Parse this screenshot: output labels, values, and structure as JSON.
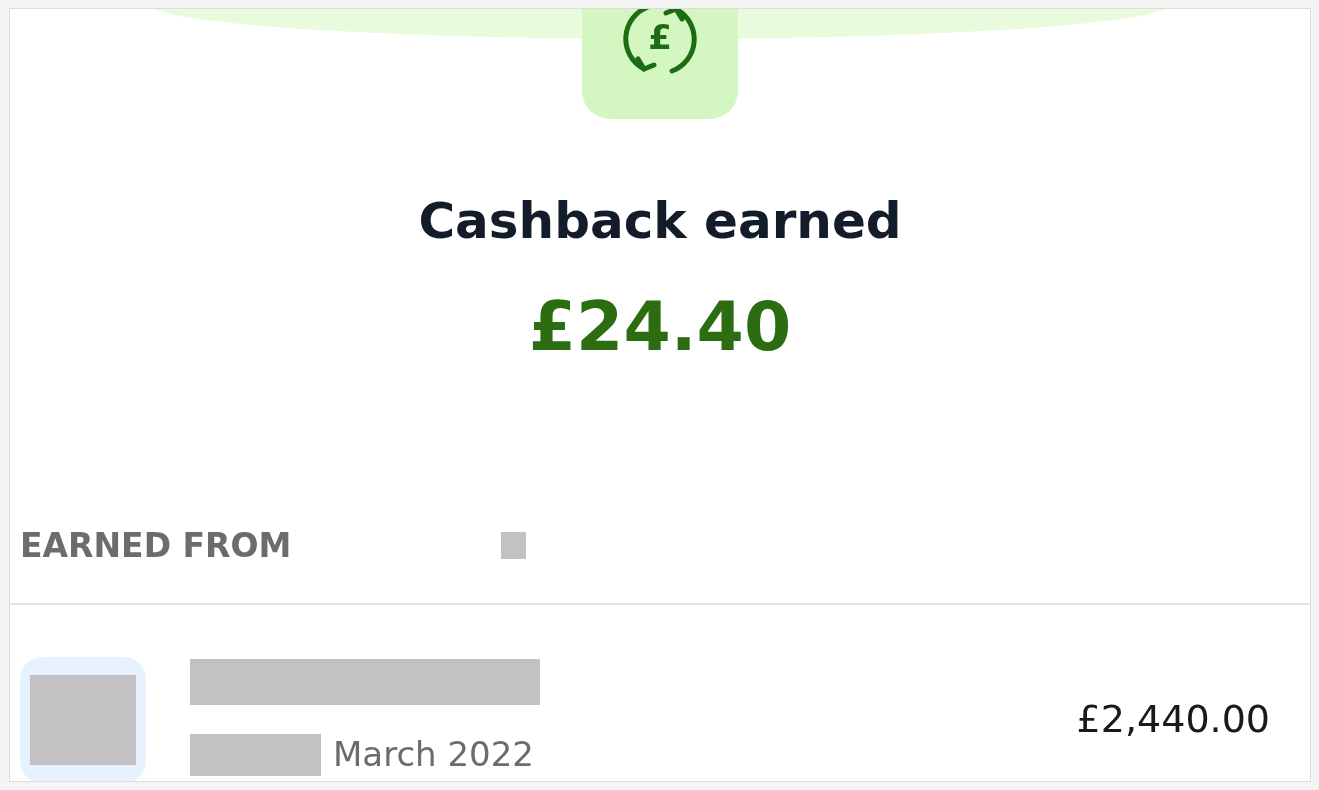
{
  "header": {
    "currency_symbol": "£",
    "title": "Cashback earned",
    "amount": "£24.40"
  },
  "section": {
    "heading": "EARNED FROM"
  },
  "transactions": [
    {
      "date_suffix": "March 2022",
      "amount": "£2,440.00"
    }
  ]
}
